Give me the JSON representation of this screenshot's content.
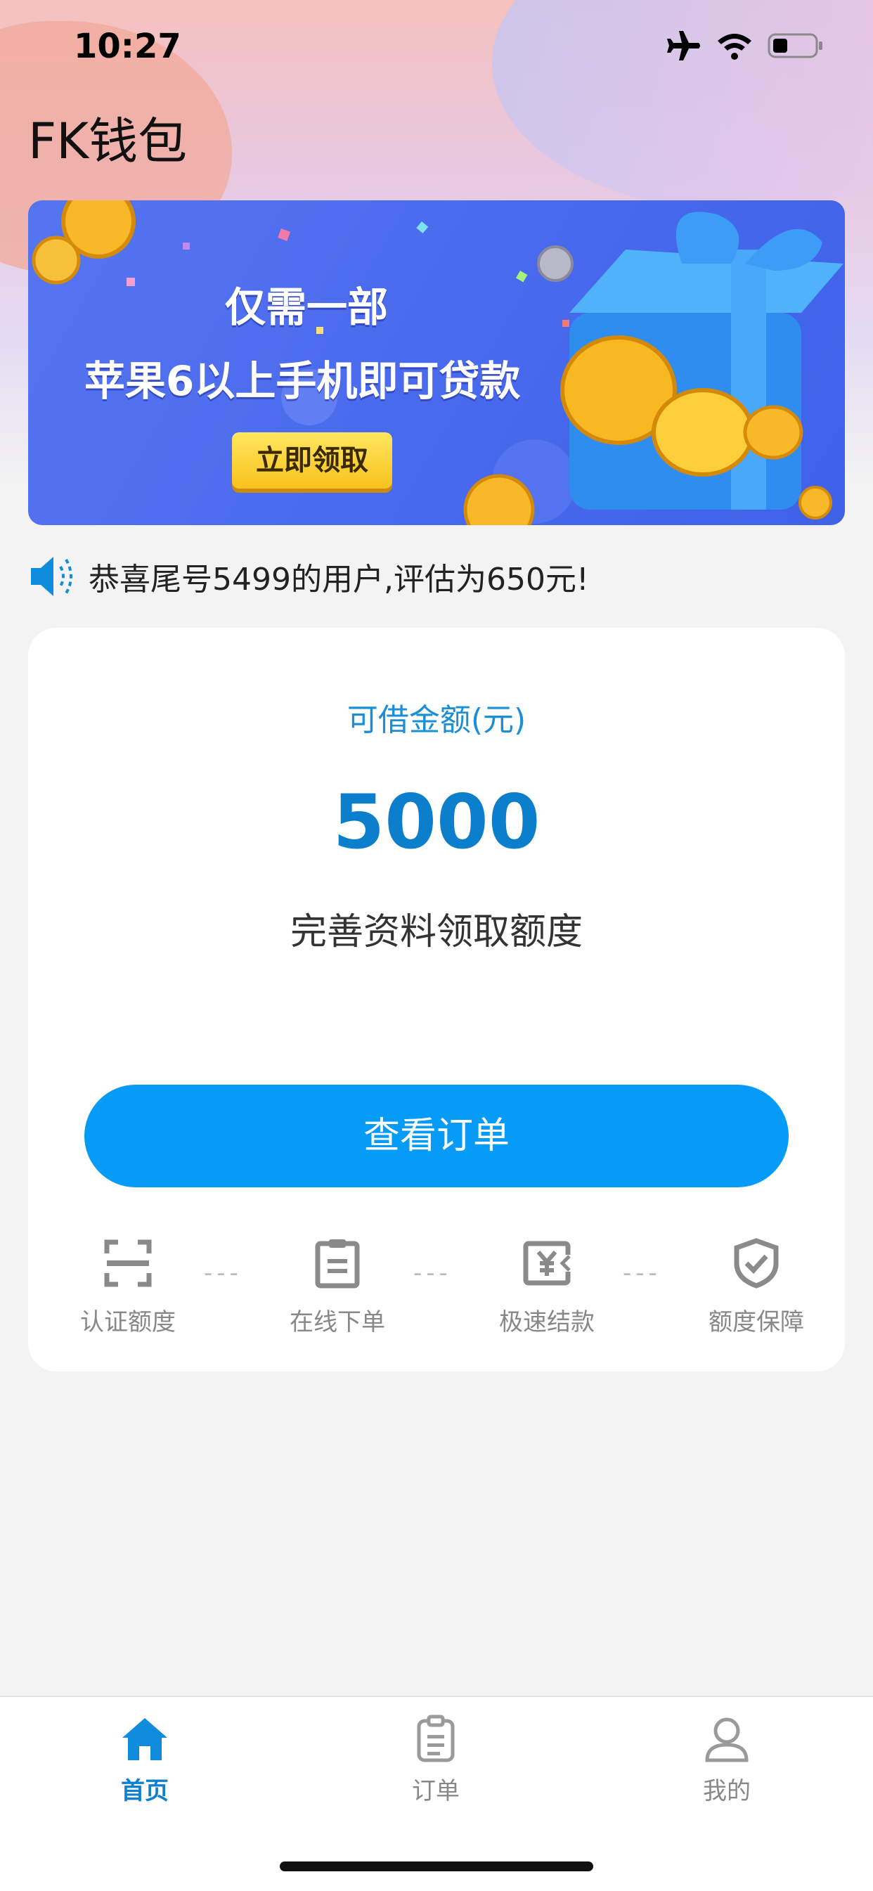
{
  "status_bar": {
    "time": "10:27",
    "icons": [
      "airplane-icon",
      "wifi-icon",
      "battery-icon"
    ]
  },
  "app": {
    "title": "FK钱包"
  },
  "banner": {
    "line1": "仅需一部",
    "line2": "苹果6以上手机即可贷款",
    "button_label": "立即领取"
  },
  "notice": {
    "icon": "speaker-icon",
    "text": "恭喜尾号5499的用户,评估为650元!"
  },
  "loan_card": {
    "amount_label": "可借金额(元)",
    "amount_value": "5000",
    "subtitle": "完善资料领取额度",
    "order_button_label": "查看订单",
    "steps": [
      {
        "label": "认证额度",
        "icon": "scan-frame-icon"
      },
      {
        "label": "在线下单",
        "icon": "clipboard-icon"
      },
      {
        "label": "极速结款",
        "icon": "fast-payment-icon"
      },
      {
        "label": "额度保障",
        "icon": "shield-check-icon"
      }
    ],
    "step_separator": "---"
  },
  "tab_bar": {
    "tabs": [
      {
        "label": "首页",
        "icon": "home-icon",
        "active": true
      },
      {
        "label": "订单",
        "icon": "order-icon",
        "active": false
      },
      {
        "label": "我的",
        "icon": "user-icon",
        "active": false
      }
    ]
  },
  "colors": {
    "accent": "#069bf7",
    "amount_text": "#0b7fcc",
    "tab_active": "#0f7fd1",
    "banner_bg": "#4a6aee",
    "banner_button": "#f9c21c"
  }
}
